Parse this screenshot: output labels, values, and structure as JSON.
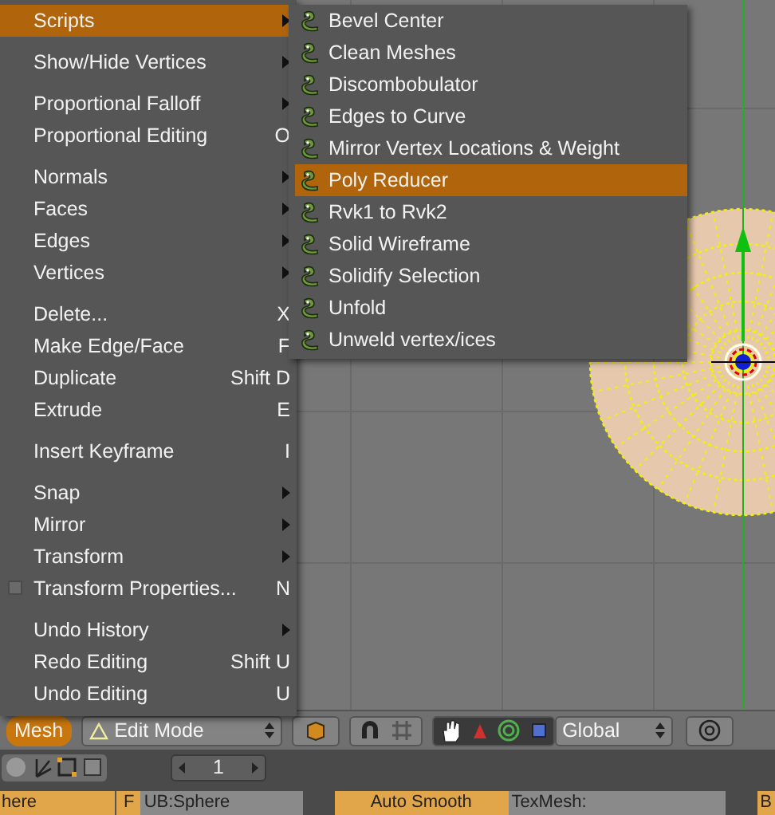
{
  "menu": {
    "groups": [
      [
        {
          "label": "Scripts",
          "submenu": true,
          "selected": true,
          "kind": "plain"
        }
      ],
      [
        {
          "label": "Show/Hide Vertices",
          "submenu": true,
          "selected": false,
          "kind": "plain"
        }
      ],
      [
        {
          "label": "Proportional Falloff",
          "submenu": true,
          "selected": false,
          "kind": "plain"
        },
        {
          "label": "Proportional Editing",
          "shortcut": "O",
          "submenu": false,
          "selected": false,
          "kind": "plain"
        }
      ],
      [
        {
          "label": "Normals",
          "submenu": true,
          "selected": false,
          "kind": "plain"
        },
        {
          "label": "Faces",
          "submenu": true,
          "selected": false,
          "kind": "plain"
        },
        {
          "label": "Edges",
          "submenu": true,
          "selected": false,
          "kind": "plain"
        },
        {
          "label": "Vertices",
          "submenu": true,
          "selected": false,
          "kind": "plain"
        }
      ],
      [
        {
          "label": "Delete...",
          "shortcut": "X",
          "submenu": false,
          "selected": false,
          "kind": "plain"
        },
        {
          "label": "Make Edge/Face",
          "shortcut": "F",
          "submenu": false,
          "selected": false,
          "kind": "plain"
        },
        {
          "label": "Duplicate",
          "shortcut": "Shift D",
          "submenu": false,
          "selected": false,
          "kind": "plain"
        },
        {
          "label": "Extrude",
          "shortcut": "E",
          "submenu": false,
          "selected": false,
          "kind": "plain"
        }
      ],
      [
        {
          "label": "Insert Keyframe",
          "shortcut": "I",
          "submenu": false,
          "selected": false,
          "kind": "plain"
        }
      ],
      [
        {
          "label": "Snap",
          "submenu": true,
          "selected": false,
          "kind": "plain"
        },
        {
          "label": "Mirror",
          "submenu": true,
          "selected": false,
          "kind": "plain"
        },
        {
          "label": "Transform",
          "submenu": true,
          "selected": false,
          "kind": "plain"
        },
        {
          "label": "Transform Properties...",
          "shortcut": "N",
          "submenu": false,
          "selected": false,
          "kind": "toggle",
          "checked": false
        }
      ],
      [
        {
          "label": "Undo History",
          "submenu": true,
          "selected": false,
          "kind": "plain"
        },
        {
          "label": "Redo Editing",
          "shortcut": "Shift U",
          "submenu": false,
          "selected": false,
          "kind": "plain"
        },
        {
          "label": "Undo Editing",
          "shortcut": "U",
          "submenu": false,
          "selected": false,
          "kind": "plain"
        }
      ]
    ]
  },
  "scripts_menu": {
    "items": [
      {
        "label": "Bevel Center",
        "selected": false
      },
      {
        "label": "Clean Meshes",
        "selected": false
      },
      {
        "label": "Discombobulator",
        "selected": false
      },
      {
        "label": "Edges to Curve",
        "selected": false
      },
      {
        "label": "Mirror Vertex Locations & Weight",
        "selected": false
      },
      {
        "label": "Poly Reducer",
        "selected": true
      },
      {
        "label": "Rvk1 to Rvk2",
        "selected": false
      },
      {
        "label": "Solid Wireframe",
        "selected": false
      },
      {
        "label": "Solidify Selection",
        "selected": false
      },
      {
        "label": "Unfold",
        "selected": false
      },
      {
        "label": "Unweld vertex/ices",
        "selected": false
      }
    ]
  },
  "header": {
    "menu_button": "Mesh",
    "mode": "Edit Mode",
    "orientation": "Global"
  },
  "buttons_panel": {
    "frame": "1",
    "object_name": "here",
    "flag": "F",
    "mesh_name": "UB:Sphere",
    "auto_smooth": "Auto Smooth",
    "tex_mesh": "TexMesh:",
    "cut_button": "B"
  }
}
